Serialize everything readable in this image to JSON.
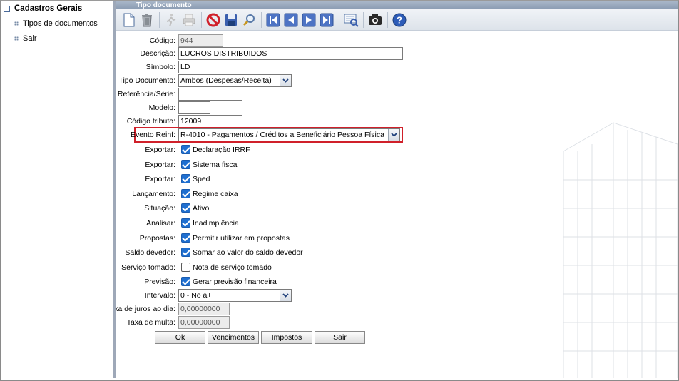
{
  "sidebar": {
    "root_label": "Cadastros Gerais",
    "items": [
      {
        "label": "Tipos de documentos"
      },
      {
        "label": "Sair"
      }
    ]
  },
  "window": {
    "title": "Tipo documento"
  },
  "toolbar": {
    "buttons": [
      "new-document-icon",
      "trash-icon",
      "run-icon",
      "print-icon",
      "cancel-icon",
      "save-icon",
      "search-icon",
      "first-record-icon",
      "previous-record-icon",
      "next-record-icon",
      "last-record-icon",
      "preview-icon",
      "camera-icon",
      "help-icon"
    ]
  },
  "form": {
    "codigo": {
      "label": "Código:",
      "value": "944"
    },
    "descricao": {
      "label": "Descrição:",
      "value": "LUCROS DISTRIBUIDOS"
    },
    "simbolo": {
      "label": "Símbolo:",
      "value": "LD"
    },
    "tipo_documento": {
      "label": "Tipo Documento:",
      "value": "Ambos (Despesas/Receita)"
    },
    "referencia_serie": {
      "label": "Referência/Série:",
      "value": ""
    },
    "modelo": {
      "label": "Modelo:",
      "value": ""
    },
    "codigo_tributo": {
      "label": "Código tributo:",
      "value": "12009"
    },
    "evento_reinf": {
      "label": "Evento Reinf:",
      "value": "R-4010 - Pagamentos / Créditos a Beneficiário Pessoa Física"
    },
    "checks": [
      {
        "label": "Exportar:",
        "text": "Declaração IRRF",
        "checked": true
      },
      {
        "label": "Exportar:",
        "text": "Sistema fiscal",
        "checked": true
      },
      {
        "label": "Exportar:",
        "text": "Sped",
        "checked": true
      },
      {
        "label": "Lançamento:",
        "text": "Regime caixa",
        "checked": true
      },
      {
        "label": "Situação:",
        "text": "Ativo",
        "checked": true
      },
      {
        "label": "Analisar:",
        "text": "Inadimplência",
        "checked": true
      },
      {
        "label": "Propostas:",
        "text": "Permitir utilizar em propostas",
        "checked": true
      },
      {
        "label": "Saldo devedor:",
        "text": "Somar ao valor do saldo devedor",
        "checked": true
      },
      {
        "label": "Serviço tomado:",
        "text": "Nota de serviço tomado",
        "checked": false
      },
      {
        "label": "Previsão:",
        "text": "Gerar previsão financeira",
        "checked": true
      }
    ],
    "intervalo": {
      "label": "Intervalo:",
      "value": "0 - No a+"
    },
    "taxa_juros": {
      "label": "Taxa de juros ao dia:",
      "value": "0,00000000"
    },
    "taxa_multa": {
      "label": "Taxa de multa:",
      "value": "0,00000000"
    }
  },
  "buttons": {
    "ok": "Ok",
    "vencimentos": "Vencimentos",
    "impostos": "Impostos",
    "sair": "Sair"
  },
  "colors": {
    "highlight": "#d0202a",
    "checkbox": "#1f6fd0",
    "titlebar": "#8a9bb2"
  }
}
